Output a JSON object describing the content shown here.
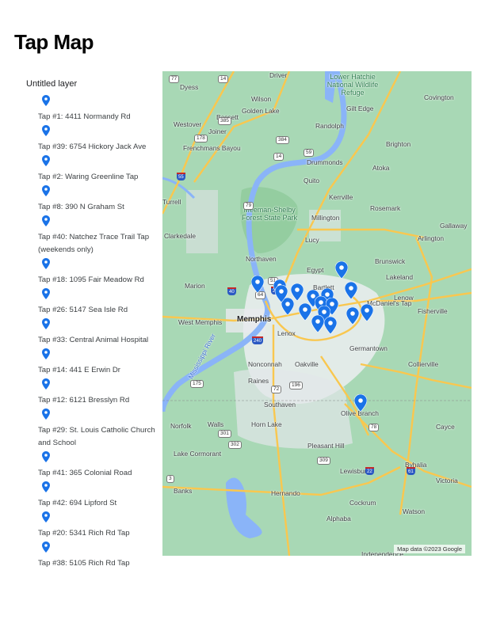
{
  "page": {
    "title": "Tap Map"
  },
  "layer": {
    "name": "Untitled layer",
    "icon": "map-pin-icon",
    "pin_color": "#1a73e8",
    "items": [
      {
        "label": "Tap #1: 4411 Normandy Rd"
      },
      {
        "label": "Tap #39: 6754 Hickory Jack Ave"
      },
      {
        "label": "Tap #2: Waring Greenline Tap"
      },
      {
        "label": "Tap #8: 390 N Graham St"
      },
      {
        "label": "Tap #40: Natchez Trace Trail Tap (weekends only)"
      },
      {
        "label": "Tap #18: 1095 Fair Meadow Rd"
      },
      {
        "label": "Tap #26: 5147 Sea Isle Rd"
      },
      {
        "label": "Tap #33: Central Animal Hospital"
      },
      {
        "label": "Tap #14: 441 E Erwin Dr"
      },
      {
        "label": "Tap #12: 6121 Bresslyn Rd"
      },
      {
        "label": "Tap #29: St. Louis Catholic Church and School"
      },
      {
        "label": "Tap #41: 365 Colonial Road"
      },
      {
        "label": "Tap #42: 694 Lipford St"
      },
      {
        "label": "Tap #20: 5341 Rich Rd Tap"
      },
      {
        "label": "Tap #38: 5105 Rich Rd Tap"
      }
    ]
  },
  "map": {
    "attribution": "Map data ©2023 Google",
    "colors": {
      "land": "#a8d8b5",
      "water": "#8ab4f8",
      "urban": "#e8eaed",
      "highway": "#f9c74f",
      "marker": "#1a73e8"
    },
    "places": [
      {
        "name": "Driver"
      },
      {
        "name": "Dyess"
      },
      {
        "name": "Wilson"
      },
      {
        "name": "Golden Lake"
      },
      {
        "name": "Bassett"
      },
      {
        "name": "Westover"
      },
      {
        "name": "Joiner"
      },
      {
        "name": "Frenchmans Bayou"
      },
      {
        "name": "Gilt Edge"
      },
      {
        "name": "Covington"
      },
      {
        "name": "Randolph"
      },
      {
        "name": "Brighton"
      },
      {
        "name": "Drummonds"
      },
      {
        "name": "Atoka"
      },
      {
        "name": "Quito"
      },
      {
        "name": "Kerrville"
      },
      {
        "name": "Rosemark"
      },
      {
        "name": "Millington"
      },
      {
        "name": "Gallaway"
      },
      {
        "name": "Clarkedale"
      },
      {
        "name": "Lucy"
      },
      {
        "name": "Arlington"
      },
      {
        "name": "Northaven"
      },
      {
        "name": "Brunswick"
      },
      {
        "name": "Egypt"
      },
      {
        "name": "Lakeland"
      },
      {
        "name": "Marion"
      },
      {
        "name": "Bartlett"
      },
      {
        "name": "Lenow"
      },
      {
        "name": "McDaniel's Tap"
      },
      {
        "name": "Fisherville"
      },
      {
        "name": "West Memphis"
      },
      {
        "name": "Memphis"
      },
      {
        "name": "Lenox"
      },
      {
        "name": "Germantown"
      },
      {
        "name": "Nonconnah"
      },
      {
        "name": "Oakville"
      },
      {
        "name": "Collierville"
      },
      {
        "name": "Raines"
      },
      {
        "name": "Southaven"
      },
      {
        "name": "Norfolk"
      },
      {
        "name": "Walls"
      },
      {
        "name": "Horn Lake"
      },
      {
        "name": "Olive Branch"
      },
      {
        "name": "Cayce"
      },
      {
        "name": "Lake Cormorant"
      },
      {
        "name": "Pleasant Hill"
      },
      {
        "name": "Byhalia"
      },
      {
        "name": "Victoria"
      },
      {
        "name": "Lewisburg"
      },
      {
        "name": "Banks"
      },
      {
        "name": "Hernando"
      },
      {
        "name": "Cockrum"
      },
      {
        "name": "Watson"
      },
      {
        "name": "Alphaba"
      },
      {
        "name": "Independence"
      },
      {
        "name": "Turrell"
      }
    ],
    "park_labels": [
      "Meeman-Shelby Forest State Park",
      "Lower Hatchie National Wildlife Refuge"
    ],
    "river_label": "Mississippi River",
    "route_shields": [
      "77",
      "14",
      "55",
      "51",
      "178",
      "384",
      "14",
      "59",
      "385",
      "79",
      "40",
      "64",
      "269",
      "240",
      "175",
      "196",
      "72",
      "301",
      "302",
      "78",
      "309",
      "22",
      "3",
      "61"
    ]
  }
}
